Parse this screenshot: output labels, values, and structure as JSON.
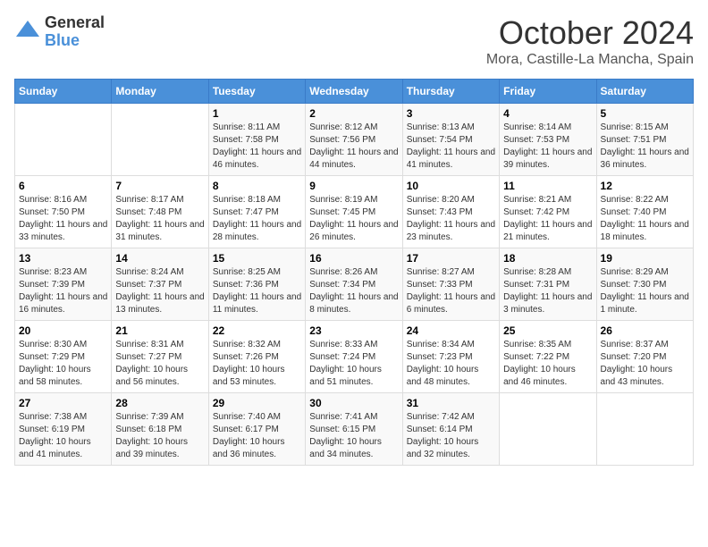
{
  "logo": {
    "general": "General",
    "blue": "Blue"
  },
  "title": "October 2024",
  "location": "Mora, Castille-La Mancha, Spain",
  "weekdays": [
    "Sunday",
    "Monday",
    "Tuesday",
    "Wednesday",
    "Thursday",
    "Friday",
    "Saturday"
  ],
  "weeks": [
    [
      {
        "day": "",
        "sunrise": "",
        "sunset": "",
        "daylight": ""
      },
      {
        "day": "",
        "sunrise": "",
        "sunset": "",
        "daylight": ""
      },
      {
        "day": "1",
        "sunrise": "Sunrise: 8:11 AM",
        "sunset": "Sunset: 7:58 PM",
        "daylight": "Daylight: 11 hours and 46 minutes."
      },
      {
        "day": "2",
        "sunrise": "Sunrise: 8:12 AM",
        "sunset": "Sunset: 7:56 PM",
        "daylight": "Daylight: 11 hours and 44 minutes."
      },
      {
        "day": "3",
        "sunrise": "Sunrise: 8:13 AM",
        "sunset": "Sunset: 7:54 PM",
        "daylight": "Daylight: 11 hours and 41 minutes."
      },
      {
        "day": "4",
        "sunrise": "Sunrise: 8:14 AM",
        "sunset": "Sunset: 7:53 PM",
        "daylight": "Daylight: 11 hours and 39 minutes."
      },
      {
        "day": "5",
        "sunrise": "Sunrise: 8:15 AM",
        "sunset": "Sunset: 7:51 PM",
        "daylight": "Daylight: 11 hours and 36 minutes."
      }
    ],
    [
      {
        "day": "6",
        "sunrise": "Sunrise: 8:16 AM",
        "sunset": "Sunset: 7:50 PM",
        "daylight": "Daylight: 11 hours and 33 minutes."
      },
      {
        "day": "7",
        "sunrise": "Sunrise: 8:17 AM",
        "sunset": "Sunset: 7:48 PM",
        "daylight": "Daylight: 11 hours and 31 minutes."
      },
      {
        "day": "8",
        "sunrise": "Sunrise: 8:18 AM",
        "sunset": "Sunset: 7:47 PM",
        "daylight": "Daylight: 11 hours and 28 minutes."
      },
      {
        "day": "9",
        "sunrise": "Sunrise: 8:19 AM",
        "sunset": "Sunset: 7:45 PM",
        "daylight": "Daylight: 11 hours and 26 minutes."
      },
      {
        "day": "10",
        "sunrise": "Sunrise: 8:20 AM",
        "sunset": "Sunset: 7:43 PM",
        "daylight": "Daylight: 11 hours and 23 minutes."
      },
      {
        "day": "11",
        "sunrise": "Sunrise: 8:21 AM",
        "sunset": "Sunset: 7:42 PM",
        "daylight": "Daylight: 11 hours and 21 minutes."
      },
      {
        "day": "12",
        "sunrise": "Sunrise: 8:22 AM",
        "sunset": "Sunset: 7:40 PM",
        "daylight": "Daylight: 11 hours and 18 minutes."
      }
    ],
    [
      {
        "day": "13",
        "sunrise": "Sunrise: 8:23 AM",
        "sunset": "Sunset: 7:39 PM",
        "daylight": "Daylight: 11 hours and 16 minutes."
      },
      {
        "day": "14",
        "sunrise": "Sunrise: 8:24 AM",
        "sunset": "Sunset: 7:37 PM",
        "daylight": "Daylight: 11 hours and 13 minutes."
      },
      {
        "day": "15",
        "sunrise": "Sunrise: 8:25 AM",
        "sunset": "Sunset: 7:36 PM",
        "daylight": "Daylight: 11 hours and 11 minutes."
      },
      {
        "day": "16",
        "sunrise": "Sunrise: 8:26 AM",
        "sunset": "Sunset: 7:34 PM",
        "daylight": "Daylight: 11 hours and 8 minutes."
      },
      {
        "day": "17",
        "sunrise": "Sunrise: 8:27 AM",
        "sunset": "Sunset: 7:33 PM",
        "daylight": "Daylight: 11 hours and 6 minutes."
      },
      {
        "day": "18",
        "sunrise": "Sunrise: 8:28 AM",
        "sunset": "Sunset: 7:31 PM",
        "daylight": "Daylight: 11 hours and 3 minutes."
      },
      {
        "day": "19",
        "sunrise": "Sunrise: 8:29 AM",
        "sunset": "Sunset: 7:30 PM",
        "daylight": "Daylight: 11 hours and 1 minute."
      }
    ],
    [
      {
        "day": "20",
        "sunrise": "Sunrise: 8:30 AM",
        "sunset": "Sunset: 7:29 PM",
        "daylight": "Daylight: 10 hours and 58 minutes."
      },
      {
        "day": "21",
        "sunrise": "Sunrise: 8:31 AM",
        "sunset": "Sunset: 7:27 PM",
        "daylight": "Daylight: 10 hours and 56 minutes."
      },
      {
        "day": "22",
        "sunrise": "Sunrise: 8:32 AM",
        "sunset": "Sunset: 7:26 PM",
        "daylight": "Daylight: 10 hours and 53 minutes."
      },
      {
        "day": "23",
        "sunrise": "Sunrise: 8:33 AM",
        "sunset": "Sunset: 7:24 PM",
        "daylight": "Daylight: 10 hours and 51 minutes."
      },
      {
        "day": "24",
        "sunrise": "Sunrise: 8:34 AM",
        "sunset": "Sunset: 7:23 PM",
        "daylight": "Daylight: 10 hours and 48 minutes."
      },
      {
        "day": "25",
        "sunrise": "Sunrise: 8:35 AM",
        "sunset": "Sunset: 7:22 PM",
        "daylight": "Daylight: 10 hours and 46 minutes."
      },
      {
        "day": "26",
        "sunrise": "Sunrise: 8:37 AM",
        "sunset": "Sunset: 7:20 PM",
        "daylight": "Daylight: 10 hours and 43 minutes."
      }
    ],
    [
      {
        "day": "27",
        "sunrise": "Sunrise: 7:38 AM",
        "sunset": "Sunset: 6:19 PM",
        "daylight": "Daylight: 10 hours and 41 minutes."
      },
      {
        "day": "28",
        "sunrise": "Sunrise: 7:39 AM",
        "sunset": "Sunset: 6:18 PM",
        "daylight": "Daylight: 10 hours and 39 minutes."
      },
      {
        "day": "29",
        "sunrise": "Sunrise: 7:40 AM",
        "sunset": "Sunset: 6:17 PM",
        "daylight": "Daylight: 10 hours and 36 minutes."
      },
      {
        "day": "30",
        "sunrise": "Sunrise: 7:41 AM",
        "sunset": "Sunset: 6:15 PM",
        "daylight": "Daylight: 10 hours and 34 minutes."
      },
      {
        "day": "31",
        "sunrise": "Sunrise: 7:42 AM",
        "sunset": "Sunset: 6:14 PM",
        "daylight": "Daylight: 10 hours and 32 minutes."
      },
      {
        "day": "",
        "sunrise": "",
        "sunset": "",
        "daylight": ""
      },
      {
        "day": "",
        "sunrise": "",
        "sunset": "",
        "daylight": ""
      }
    ]
  ]
}
